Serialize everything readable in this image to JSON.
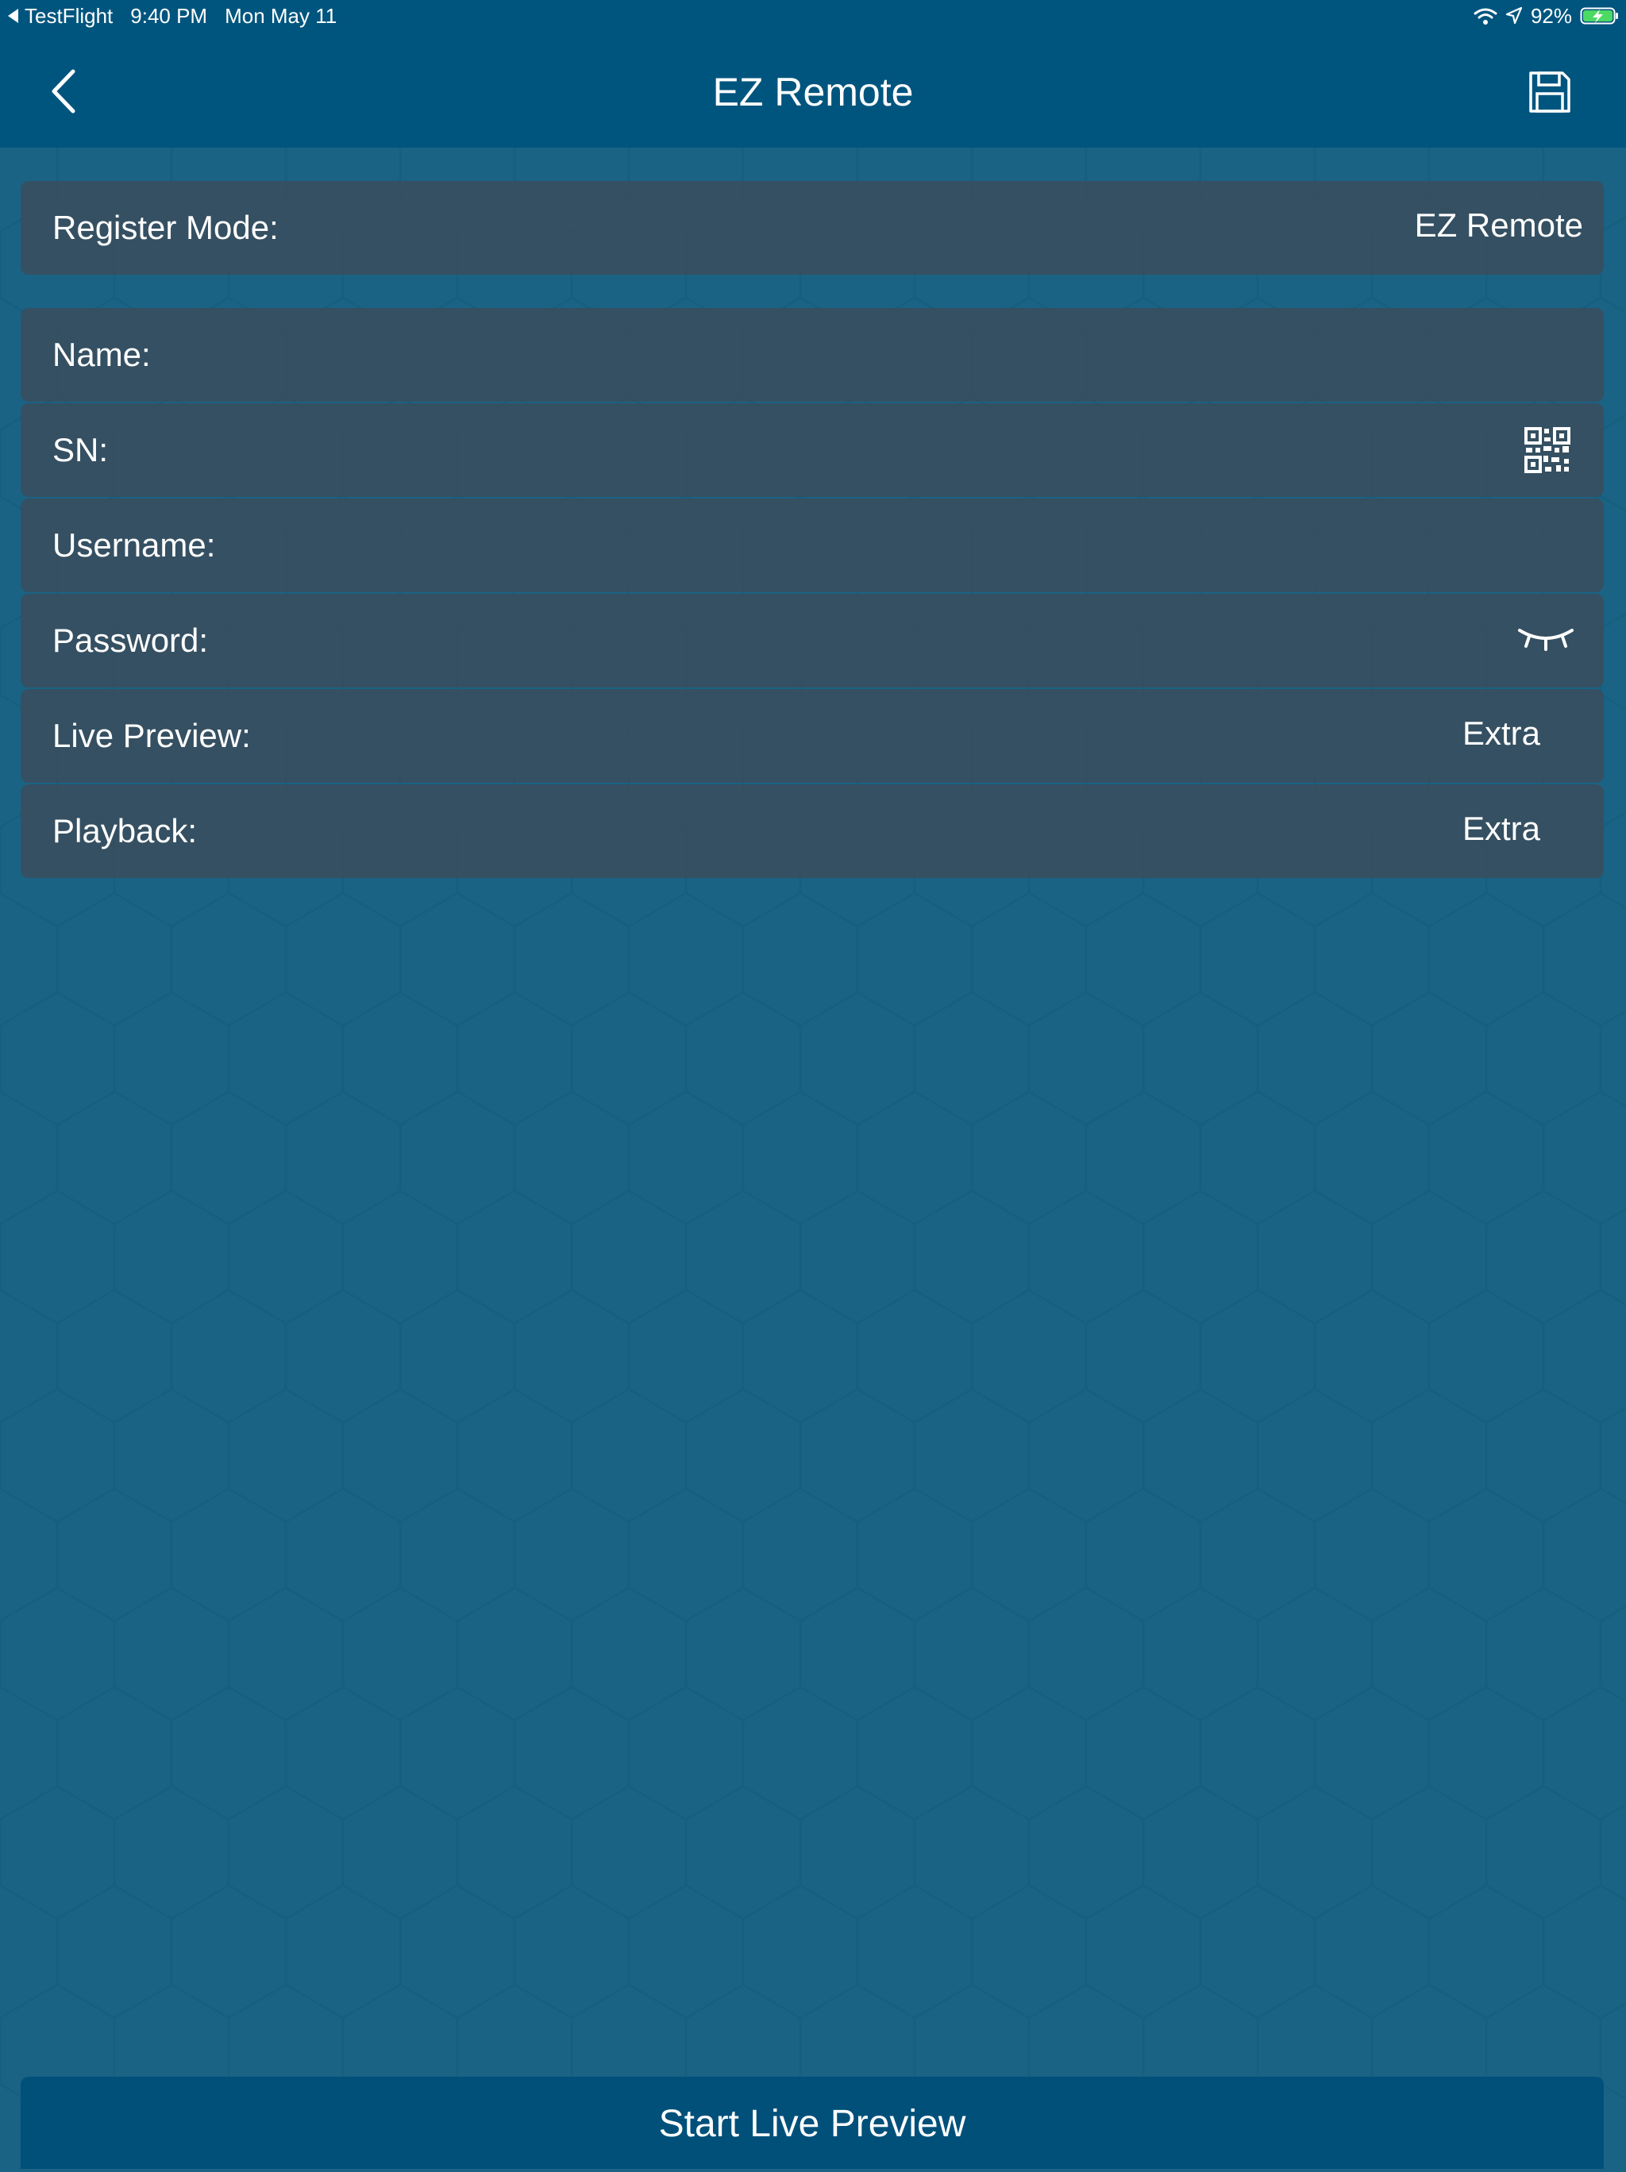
{
  "status_bar": {
    "back_app": "TestFlight",
    "time": "9:40 PM",
    "date": "Mon May 11",
    "battery_percent": "92%"
  },
  "nav": {
    "title": "EZ Remote"
  },
  "form": {
    "register_mode": {
      "label": "Register Mode:",
      "value": "EZ Remote"
    },
    "name": {
      "label": "Name:"
    },
    "sn": {
      "label": "SN:"
    },
    "username": {
      "label": "Username:"
    },
    "password": {
      "label": "Password:"
    },
    "live_preview": {
      "label": "Live Preview:",
      "value": "Extra"
    },
    "playback": {
      "label": "Playback:",
      "value": "Extra"
    }
  },
  "actions": {
    "start_live_preview": "Start Live Preview"
  },
  "colors": {
    "header_bg": "#00557e",
    "body_bg": "#1a6385",
    "row_bg": "#404a54",
    "button_bg": "#00507a",
    "battery_fill": "#4cd964"
  }
}
